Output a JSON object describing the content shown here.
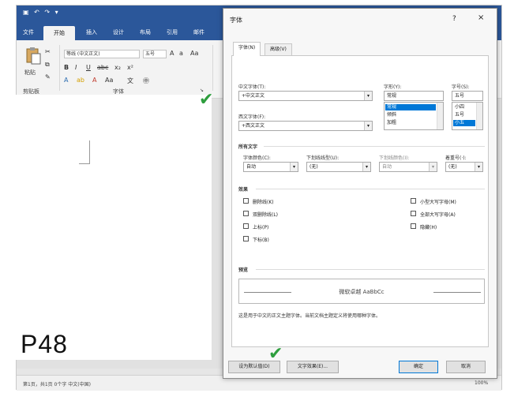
{
  "ribbon": {
    "tabs": [
      "文件",
      "开始",
      "插入",
      "设计",
      "布局",
      "引用",
      "邮件"
    ],
    "active_tab": "开始",
    "paste_label": "粘贴",
    "clipboard_group": "剪贴板",
    "font_group": "字体",
    "font_name": "等线 (中文正文)",
    "font_size": "五号"
  },
  "document": {
    "page_label": "P48"
  },
  "status": {
    "left": "第1页，共1页  0个字  中文(中国)",
    "zoom": "100%"
  },
  "dialog": {
    "title": "字体",
    "help": "?",
    "close": "×",
    "tabs": [
      "字体(N)",
      "高级(V)"
    ],
    "chinese_font_label": "中文字体(T):",
    "chinese_font_value": "+中文正文",
    "western_font_label": "西文字体(F):",
    "western_font_value": "+西文正文",
    "style_label": "字形(Y):",
    "style_value": "常规",
    "style_options": [
      "常规",
      "倾斜",
      "加粗"
    ],
    "size_label": "字号(S):",
    "size_value": "五号",
    "size_options": [
      "小四",
      "五号",
      "小五"
    ],
    "all_text_label": "所有文字",
    "font_color_label": "字体颜色(C):",
    "font_color_value": "自动",
    "underline_style_label": "下划线线型(U):",
    "underline_style_value": "(无)",
    "underline_color_label": "下划线颜色(I):",
    "underline_color_value": "自动",
    "emphasis_label": "着重号(·):",
    "emphasis_value": "(无)",
    "effects_label": "效果",
    "effects": {
      "strikethrough": "删除线(K)",
      "double_strike": "双删除线(L)",
      "superscript": "上标(P)",
      "subscript": "下标(B)",
      "small_caps": "小型大写字母(M)",
      "all_caps": "全部大写字母(A)",
      "hidden": "隐藏(H)"
    },
    "preview_label": "预览",
    "preview_text": "微软卓越 AaBbCc",
    "note": "这是用于中文的正文主题字体。当前文档主题定义将使用哪种字体。",
    "set_default_button": "设为默认值(D)",
    "text_effects_button": "文字效果(E)...",
    "ok_button": "确定",
    "cancel_button": "取消"
  },
  "colors": {
    "word_blue": "#2b579a",
    "accent_select": "#0078d7",
    "check_green": "#2e9e3e"
  }
}
